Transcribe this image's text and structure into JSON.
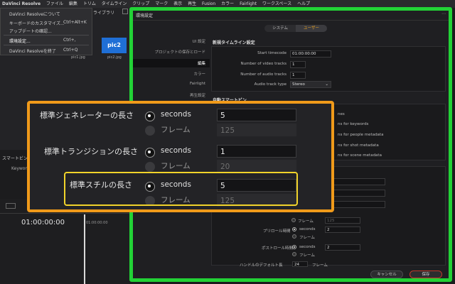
{
  "menubar": {
    "app": "DaVinci Resolve",
    "items": [
      "ファイル",
      "編集",
      "トリム",
      "タイムライン",
      "クリップ",
      "マーク",
      "表示",
      "再生",
      "Fusion",
      "カラー",
      "Fairlight",
      "ワークスペース",
      "ヘルプ"
    ]
  },
  "app_menu": {
    "items": [
      {
        "label": "DaVinci Resolveについて",
        "shortcut": ""
      },
      {
        "label": "キーボードのカスタマイズ...",
        "shortcut": "Ctrl+Alt+K"
      },
      {
        "label": "アップデートの確認...",
        "shortcut": ""
      },
      {
        "label": "環境設定...",
        "shortcut": "Ctrl+,"
      },
      {
        "label": "DaVinci Resolveを終了",
        "shortcut": "Ctrl+Q"
      }
    ]
  },
  "background": {
    "library_tab": "ライブラリ",
    "clip1_name": "pic1.jpg",
    "clip2_name": "pic2.jpg",
    "clip2_thumb": "pic2",
    "smart_bin": "スマートビン",
    "keywords": "Keyword",
    "timecode": "01:00:00:00",
    "ruler_tc": "01:00:00:00"
  },
  "dialog": {
    "title": "環境設定",
    "tabs": {
      "system": "システム",
      "user": "ユーザー"
    },
    "sidebar": [
      "UI 設定",
      "プロジェクトの保存とロード",
      "編集",
      "カラー",
      "Fairlight",
      "再生設定"
    ],
    "new_timeline": {
      "heading": "新規タイムライン設定",
      "start_timecode_label": "Start timecode",
      "start_timecode": "01:00:00:00",
      "video_tracks_label": "Number of video tracks",
      "video_tracks": "1",
      "audio_tracks_label": "Number of audio tracks",
      "audio_tracks": "1",
      "audio_type_label": "Audio track type",
      "audio_type": "Stereo"
    },
    "smart_bins": {
      "heading": "自動スマートビン",
      "items": [
        "nes",
        "ns for keywords",
        "ns for people metadata",
        "ns for shot metadata",
        "ns for scene metadata"
      ]
    },
    "lower": {
      "frame": "フレーム",
      "frame_value": "125",
      "preroll_label": "プリロール時間",
      "postroll_label": "ポストロール時間",
      "seconds": "seconds",
      "preroll_value": "2",
      "postroll_value": "2",
      "bottom_label": "ハンドルのデフォルト長",
      "bottom_value": "24",
      "bottom_unit": "フレーム"
    },
    "cancel": "キャンセル",
    "save": "保存"
  },
  "zoom": {
    "rows": [
      {
        "label": "標準ジェネレーターの長さ",
        "seconds": "seconds",
        "seconds_value": "5",
        "frames": "フレーム",
        "frames_value": "125"
      },
      {
        "label": "標準トランジションの長さ",
        "seconds": "seconds",
        "seconds_value": "1",
        "frames": "フレーム",
        "frames_value": "20"
      },
      {
        "label": "標準スチルの長さ",
        "seconds": "seconds",
        "seconds_value": "5",
        "frames": "フレーム",
        "frames_value": "125"
      }
    ]
  },
  "colors": {
    "green_highlight": "#22d236",
    "orange_callout": "#f09a1a",
    "yellow_highlight": "#f1d32a",
    "save_accent": "#c0392b",
    "pic2_blue": "#1f6fd6"
  }
}
